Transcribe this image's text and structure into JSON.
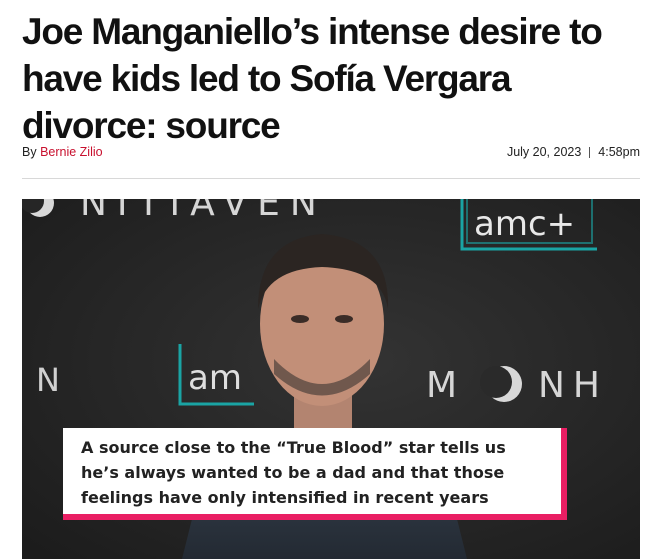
{
  "article": {
    "headline": "Joe Manganiello’s intense desire to have kids led to Sofía Vergara divorce: source",
    "byline_prefix": "By ",
    "author": "Bernie Zilio",
    "date": "July 20, 2023",
    "time": "4:58pm"
  },
  "video": {
    "backdrop_left_text": "NITIAVEN",
    "backdrop_brand": "amc+",
    "backdrop_mid_left": "N",
    "backdrop_amc_mid": "am",
    "backdrop_right_text": "M",
    "backdrop_right_text2": "NH",
    "caption": "A source close to the “True Blood” star tells us he’s always wanted to be a dad and that those feelings have only intensified in recent years",
    "accent_color": "#e91e63"
  }
}
